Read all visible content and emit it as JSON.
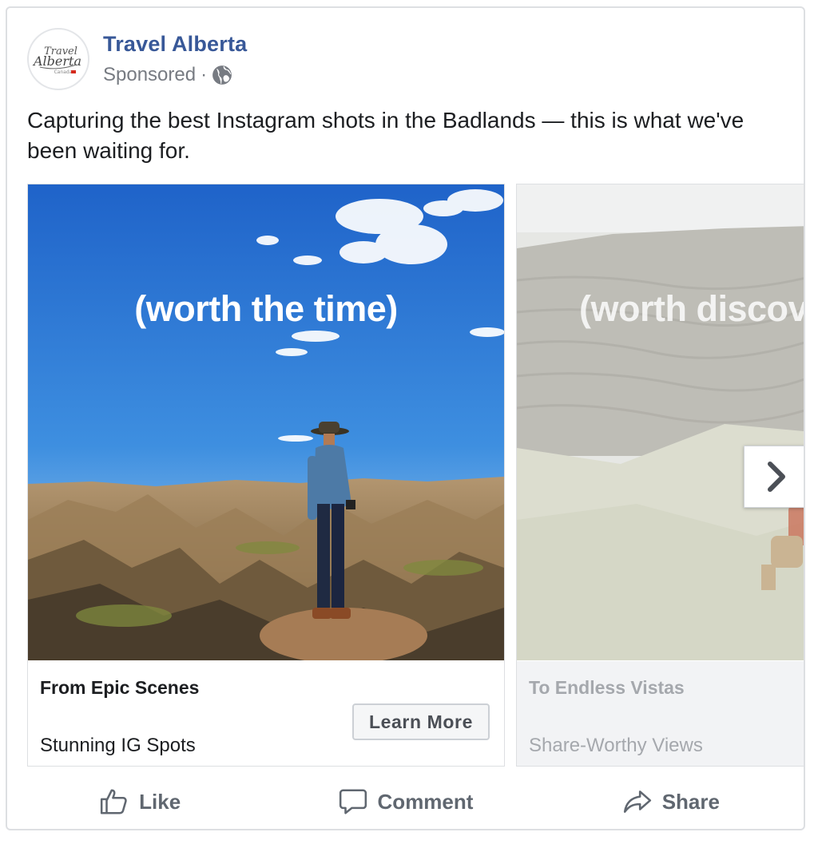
{
  "post": {
    "page_name": "Travel Alberta",
    "sponsored_label": "Sponsored",
    "separator": "·",
    "audience_icon": "globe-icon",
    "caption": "Capturing the best Instagram shots in the Badlands — this is what we've been waiting for.",
    "avatar": {
      "logo_text_top": "Travel",
      "logo_text_main": "Alberta",
      "logo_text_sub": "Canada"
    }
  },
  "carousel": {
    "cards": [
      {
        "overlay_text": "(worth the time)",
        "title": "From Epic Scenes",
        "subtitle": "Stunning IG Spots",
        "cta_label": "Learn More"
      },
      {
        "overlay_text": "(worth discov",
        "title": "To Endless Vistas",
        "subtitle": "Share-Worthy Views"
      }
    ],
    "next_icon": "chevron-right-icon"
  },
  "actions": [
    {
      "label": "Like",
      "icon": "thumbs-up-icon"
    },
    {
      "label": "Comment",
      "icon": "comment-icon"
    },
    {
      "label": "Share",
      "icon": "share-icon"
    }
  ],
  "colors": {
    "link": "#385898",
    "muted": "#606770",
    "border": "#dddfe2"
  }
}
